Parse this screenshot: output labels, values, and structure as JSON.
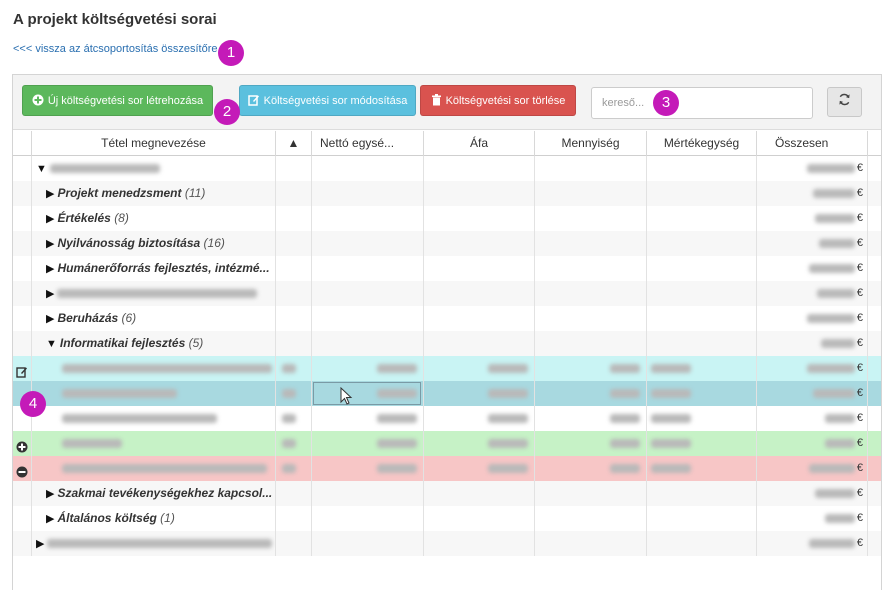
{
  "page": {
    "title": "A projekt költségvetési sorai",
    "back_link": "<<< vissza az átcsoportosítás összesítőre"
  },
  "markers": [
    "1",
    "2",
    "3",
    "4"
  ],
  "toolbar": {
    "new_label": "Új költségvetési sor létrehozása",
    "edit_label": "Költségvetési sor módosítása",
    "delete_label": "Költségvetési sor törlése",
    "search_placeholder": "kereső..."
  },
  "colors": {
    "new": "#5cb85c",
    "edit": "#5bc0de",
    "delete": "#d9534f",
    "row_edited": "#c9f4f4",
    "row_selected": "#a8d9e0",
    "row_added": "#c6f2c6",
    "row_deleted": "#f7c6c6",
    "marker": "#c41ab8"
  },
  "grid": {
    "columns": [
      "Tétel megnevezése",
      "▲",
      "Nettó egysé...",
      "Áfa",
      "Mennyiség",
      "Mértékegység",
      "Összesen"
    ],
    "currency": "€",
    "rows": [
      {
        "kind": "root",
        "tri": "▼",
        "name": "",
        "count": "",
        "blurred": true,
        "status": ""
      },
      {
        "kind": "group",
        "tri": "▶",
        "name": "Projekt menedzsment",
        "count": "(11)",
        "blurred": false,
        "status": ""
      },
      {
        "kind": "group",
        "tri": "▶",
        "name": "Értékelés",
        "count": "(8)",
        "blurred": false,
        "status": ""
      },
      {
        "kind": "group",
        "tri": "▶",
        "name": "Nyilvánosság biztosítása",
        "count": "(16)",
        "blurred": false,
        "status": ""
      },
      {
        "kind": "group",
        "tri": "▶",
        "name": "Humánerőforrás fejlesztés, intézmé...",
        "count": "",
        "blurred": false,
        "status": ""
      },
      {
        "kind": "group",
        "tri": "▶",
        "name": "",
        "count": "",
        "blurred": true,
        "status": ""
      },
      {
        "kind": "group",
        "tri": "▶",
        "name": "Beruházás",
        "count": "(6)",
        "blurred": false,
        "status": ""
      },
      {
        "kind": "group",
        "tri": "▼",
        "name": "Informatikai fejlesztés",
        "count": "(5)",
        "blurred": false,
        "status": ""
      },
      {
        "kind": "item",
        "tri": "",
        "name": "",
        "count": "",
        "blurred": true,
        "status": "edited"
      },
      {
        "kind": "item",
        "tri": "",
        "name": "",
        "count": "",
        "blurred": true,
        "status": "selected"
      },
      {
        "kind": "item",
        "tri": "",
        "name": "",
        "count": "",
        "blurred": true,
        "status": ""
      },
      {
        "kind": "item",
        "tri": "",
        "name": "",
        "count": "",
        "blurred": true,
        "status": "added"
      },
      {
        "kind": "item",
        "tri": "",
        "name": "",
        "count": "",
        "blurred": true,
        "status": "deleted"
      },
      {
        "kind": "group",
        "tri": "▶",
        "name": "Szakmai tevékenységekhez kapcsol...",
        "count": "",
        "blurred": false,
        "status": ""
      },
      {
        "kind": "group",
        "tri": "▶",
        "name": "Általános költség",
        "count": "(1)",
        "blurred": false,
        "status": ""
      },
      {
        "kind": "root",
        "tri": "▶",
        "name": "",
        "count": "",
        "blurred": true,
        "status": ""
      }
    ]
  }
}
